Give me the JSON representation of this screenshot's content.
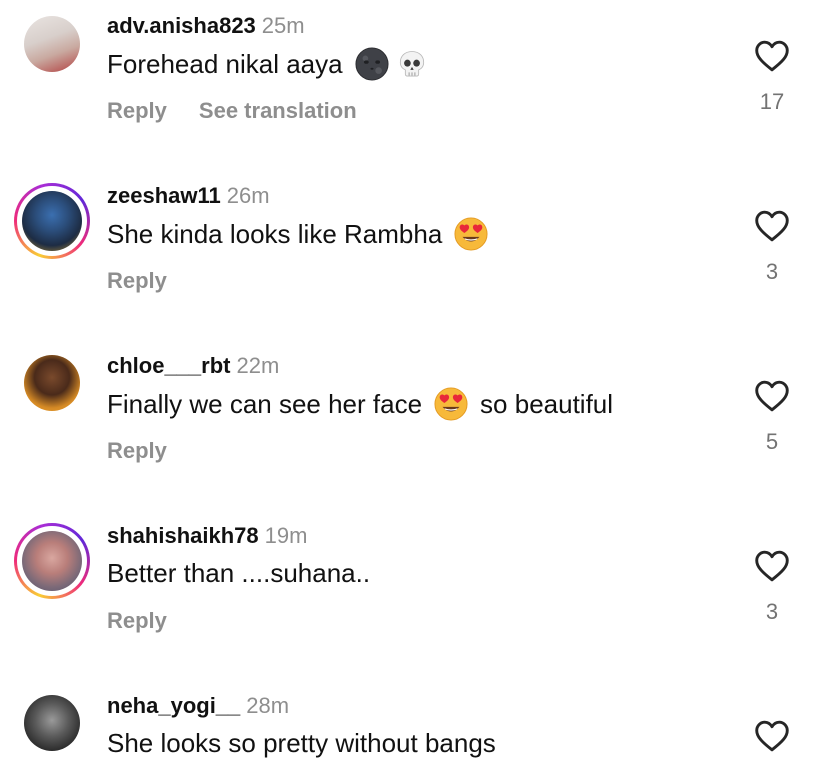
{
  "comments": [
    {
      "username": "adv.anisha823",
      "time": "25m",
      "text": "Forehead nikal aaya",
      "emoji_after": [
        "new-moon-face-emoji",
        "skull-emoji"
      ],
      "actions": {
        "reply": "Reply",
        "translate": "See translation"
      },
      "likes": "17",
      "avatar_story_ring": false
    },
    {
      "username": "zeeshaw11",
      "time": "26m",
      "text": "She kinda looks like Rambha",
      "emoji_after": [
        "heart-eyes-emoji"
      ],
      "actions": {
        "reply": "Reply"
      },
      "likes": "3",
      "avatar_story_ring": true
    },
    {
      "username": "chloe___rbt",
      "time": "22m",
      "text_before": "Finally we can see her face",
      "text_after": "so beautiful",
      "emoji_after": [
        "heart-eyes-emoji"
      ],
      "actions": {
        "reply": "Reply"
      },
      "likes": "5",
      "avatar_story_ring": false
    },
    {
      "username": "shahishaikh78",
      "time": "19m",
      "text": "Better than ....suhana..",
      "actions": {
        "reply": "Reply"
      },
      "likes": "3",
      "avatar_story_ring": true
    },
    {
      "username": "neha_yogi__",
      "time": "28m",
      "text": "She looks so pretty without bangs",
      "avatar_story_ring": false
    }
  ],
  "colors": {
    "text": "#111111",
    "secondary": "#8e8e8e",
    "story_ring": [
      "#f9ce34",
      "#ee2a7b",
      "#6228d7"
    ]
  }
}
